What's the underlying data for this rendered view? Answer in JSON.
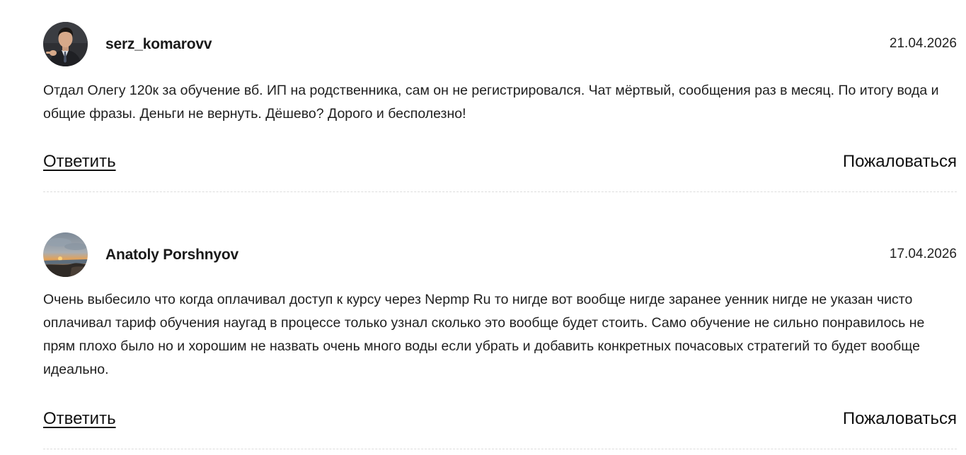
{
  "comments": [
    {
      "username": "serz_komarovv",
      "date": "21.04.2026",
      "text": "Отдал Олегу 120к за обучение вб. ИП на родственника, сам он не регистрировался. Чат мёртвый, сообщения раз в месяц. По итогу вода и общие фразы. Деньги не вернуть. Дёшево? Дорого и бесполезно!",
      "reply_label": "Ответить",
      "report_label": "Пожаловаться",
      "avatar_icon": "person-photo-avatar"
    },
    {
      "username": "Anatoly Porshnyov",
      "date": "17.04.2026",
      "text": "Очень выбесило что когда оплачивал доступ к курсу через Nepmp Ru то нигде вот вообще нигде заранее уенник нигде не указан чисто оплачивал тариф обучения наугад в процессе только узнал сколько это вообще будет стоить. Само обучение не сильно понравилось не прям плохо было но и хорошим не назвать очень много воды если убрать и добавить конкретных почасовых стратегий то будет вообще идеально.",
      "reply_label": "Ответить",
      "report_label": "Пожаловаться",
      "avatar_icon": "sunset-landscape-avatar"
    }
  ]
}
